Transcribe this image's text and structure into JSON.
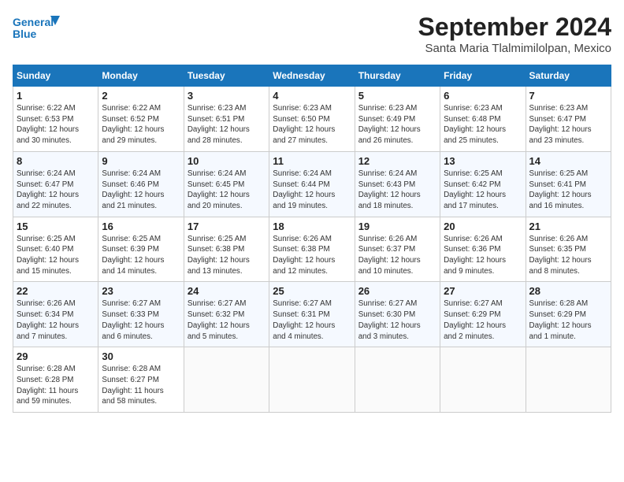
{
  "logo": {
    "line1": "General",
    "line2": "Blue"
  },
  "title": "September 2024",
  "subtitle": "Santa Maria Tlalmimilolpan, Mexico",
  "headers": [
    "Sunday",
    "Monday",
    "Tuesday",
    "Wednesday",
    "Thursday",
    "Friday",
    "Saturday"
  ],
  "weeks": [
    [
      {
        "day": "1",
        "info": "Sunrise: 6:22 AM\nSunset: 6:53 PM\nDaylight: 12 hours\nand 30 minutes."
      },
      {
        "day": "2",
        "info": "Sunrise: 6:22 AM\nSunset: 6:52 PM\nDaylight: 12 hours\nand 29 minutes."
      },
      {
        "day": "3",
        "info": "Sunrise: 6:23 AM\nSunset: 6:51 PM\nDaylight: 12 hours\nand 28 minutes."
      },
      {
        "day": "4",
        "info": "Sunrise: 6:23 AM\nSunset: 6:50 PM\nDaylight: 12 hours\nand 27 minutes."
      },
      {
        "day": "5",
        "info": "Sunrise: 6:23 AM\nSunset: 6:49 PM\nDaylight: 12 hours\nand 26 minutes."
      },
      {
        "day": "6",
        "info": "Sunrise: 6:23 AM\nSunset: 6:48 PM\nDaylight: 12 hours\nand 25 minutes."
      },
      {
        "day": "7",
        "info": "Sunrise: 6:23 AM\nSunset: 6:47 PM\nDaylight: 12 hours\nand 23 minutes."
      }
    ],
    [
      {
        "day": "8",
        "info": "Sunrise: 6:24 AM\nSunset: 6:47 PM\nDaylight: 12 hours\nand 22 minutes."
      },
      {
        "day": "9",
        "info": "Sunrise: 6:24 AM\nSunset: 6:46 PM\nDaylight: 12 hours\nand 21 minutes."
      },
      {
        "day": "10",
        "info": "Sunrise: 6:24 AM\nSunset: 6:45 PM\nDaylight: 12 hours\nand 20 minutes."
      },
      {
        "day": "11",
        "info": "Sunrise: 6:24 AM\nSunset: 6:44 PM\nDaylight: 12 hours\nand 19 minutes."
      },
      {
        "day": "12",
        "info": "Sunrise: 6:24 AM\nSunset: 6:43 PM\nDaylight: 12 hours\nand 18 minutes."
      },
      {
        "day": "13",
        "info": "Sunrise: 6:25 AM\nSunset: 6:42 PM\nDaylight: 12 hours\nand 17 minutes."
      },
      {
        "day": "14",
        "info": "Sunrise: 6:25 AM\nSunset: 6:41 PM\nDaylight: 12 hours\nand 16 minutes."
      }
    ],
    [
      {
        "day": "15",
        "info": "Sunrise: 6:25 AM\nSunset: 6:40 PM\nDaylight: 12 hours\nand 15 minutes."
      },
      {
        "day": "16",
        "info": "Sunrise: 6:25 AM\nSunset: 6:39 PM\nDaylight: 12 hours\nand 14 minutes."
      },
      {
        "day": "17",
        "info": "Sunrise: 6:25 AM\nSunset: 6:38 PM\nDaylight: 12 hours\nand 13 minutes."
      },
      {
        "day": "18",
        "info": "Sunrise: 6:26 AM\nSunset: 6:38 PM\nDaylight: 12 hours\nand 12 minutes."
      },
      {
        "day": "19",
        "info": "Sunrise: 6:26 AM\nSunset: 6:37 PM\nDaylight: 12 hours\nand 10 minutes."
      },
      {
        "day": "20",
        "info": "Sunrise: 6:26 AM\nSunset: 6:36 PM\nDaylight: 12 hours\nand 9 minutes."
      },
      {
        "day": "21",
        "info": "Sunrise: 6:26 AM\nSunset: 6:35 PM\nDaylight: 12 hours\nand 8 minutes."
      }
    ],
    [
      {
        "day": "22",
        "info": "Sunrise: 6:26 AM\nSunset: 6:34 PM\nDaylight: 12 hours\nand 7 minutes."
      },
      {
        "day": "23",
        "info": "Sunrise: 6:27 AM\nSunset: 6:33 PM\nDaylight: 12 hours\nand 6 minutes."
      },
      {
        "day": "24",
        "info": "Sunrise: 6:27 AM\nSunset: 6:32 PM\nDaylight: 12 hours\nand 5 minutes."
      },
      {
        "day": "25",
        "info": "Sunrise: 6:27 AM\nSunset: 6:31 PM\nDaylight: 12 hours\nand 4 minutes."
      },
      {
        "day": "26",
        "info": "Sunrise: 6:27 AM\nSunset: 6:30 PM\nDaylight: 12 hours\nand 3 minutes."
      },
      {
        "day": "27",
        "info": "Sunrise: 6:27 AM\nSunset: 6:29 PM\nDaylight: 12 hours\nand 2 minutes."
      },
      {
        "day": "28",
        "info": "Sunrise: 6:28 AM\nSunset: 6:29 PM\nDaylight: 12 hours\nand 1 minute."
      }
    ],
    [
      {
        "day": "29",
        "info": "Sunrise: 6:28 AM\nSunset: 6:28 PM\nDaylight: 11 hours\nand 59 minutes."
      },
      {
        "day": "30",
        "info": "Sunrise: 6:28 AM\nSunset: 6:27 PM\nDaylight: 11 hours\nand 58 minutes."
      },
      {
        "day": "",
        "info": ""
      },
      {
        "day": "",
        "info": ""
      },
      {
        "day": "",
        "info": ""
      },
      {
        "day": "",
        "info": ""
      },
      {
        "day": "",
        "info": ""
      }
    ]
  ]
}
